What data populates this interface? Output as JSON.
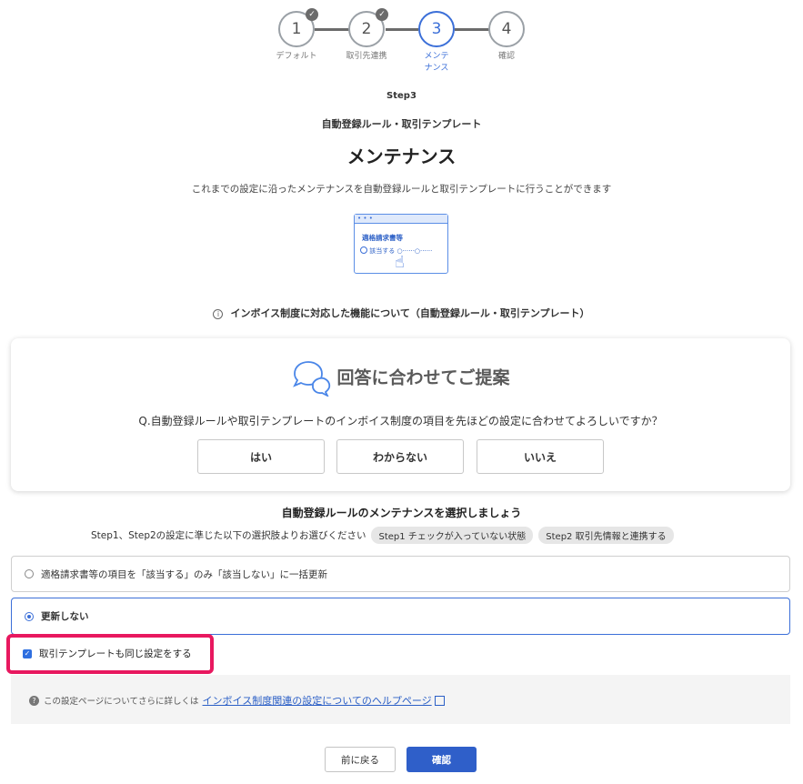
{
  "stepper": {
    "steps": [
      {
        "number": "1",
        "label": "デフォルト",
        "done": true
      },
      {
        "number": "2",
        "label": "取引先連携",
        "done": true
      },
      {
        "number": "3",
        "label": "メンテ\nナンス",
        "active": true
      },
      {
        "number": "4",
        "label": "確認"
      }
    ],
    "check_glyph": "✓"
  },
  "header": {
    "step": "Step3",
    "subtitle": "自動登録ルール・取引テンプレート",
    "title": "メンテナンス",
    "description": "これまでの設定に沿ったメンテナンスを自動登録ルールと取引テンプレートに行うことができます"
  },
  "illustration": {
    "dots": "• • •",
    "title": "適格請求書等",
    "option": "該当する"
  },
  "info": {
    "icon": "i",
    "text": "インボイス制度に対応した機能について（自動登録ルール・取引テンプレート）"
  },
  "suggest": {
    "heading": "回答に合わせてご提案",
    "question": "Q.自動登録ルールや取引テンプレートのインボイス制度の項目を先ほどの設定に合わせてよろしいですか？",
    "answers": [
      "はい",
      "わからない",
      "いいえ"
    ]
  },
  "maintenance": {
    "title": "自動登録ルールのメンテナンスを選択しましょう",
    "description": "Step1、Step2の設定に準じた以下の選択肢よりお選びください",
    "tags": [
      "Step1 チェックが入っていない状態",
      "Step2 取引先情報と連携する"
    ],
    "options": [
      {
        "label": "適格請求書等の項目を「該当する」のみ「該当しない」に一括更新",
        "selected": false
      },
      {
        "label": "更新しない",
        "selected": true
      }
    ],
    "checkbox_label": "取引テンプレートも同じ設定をする",
    "checkbox_checked": true
  },
  "help": {
    "icon": "?",
    "text": "この設定ページについてさらに詳しくは",
    "link": "インボイス制度関連の設定についてのヘルプページ"
  },
  "footer": {
    "back": "前に戻る",
    "confirm": "確認"
  },
  "colors": {
    "accent": "#3b6fd8",
    "highlight": "#e8185f",
    "primary_button": "#2f5fc9"
  }
}
